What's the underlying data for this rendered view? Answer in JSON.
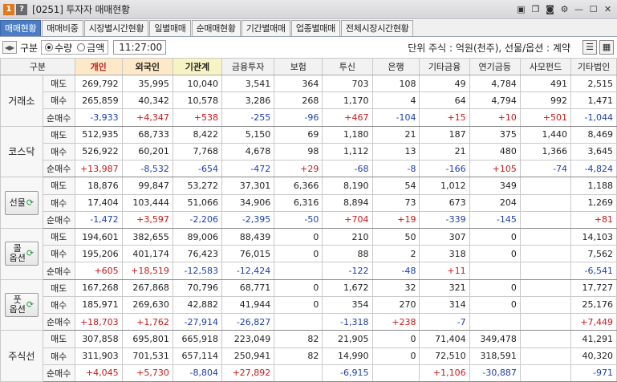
{
  "titlebar": {
    "badge_one": "1",
    "badge_q": "?",
    "title": "[0251] 투자자 매매현황",
    "icons": [
      "window-icon",
      "copy-icon",
      "camera-icon",
      "gear-icon",
      "minimize-icon",
      "maximize-icon",
      "close-icon"
    ]
  },
  "tabs": [
    "매매현황",
    "매매비중",
    "시장별시간현황",
    "일별매매",
    "순매매현황",
    "기간별매매",
    "업종별매매",
    "전체시장시간현황"
  ],
  "controls": {
    "group_label": "구분",
    "radio_qty": "수량",
    "radio_amount": "금액",
    "time": "11:27:00",
    "unit_text": "단위 주식 : 억원(천주), 선물/옵션 : 계약"
  },
  "table": {
    "columns": [
      "구분",
      "",
      "개인",
      "외국인",
      "기관계",
      "금융투자",
      "보험",
      "투신",
      "은행",
      "기타금융",
      "연기금등",
      "사모펀드",
      "기타법인"
    ],
    "groups": [
      {
        "name": "거래소",
        "button": false,
        "rows": [
          {
            "label": "매도",
            "values": [
              "269,792",
              "35,995",
              "10,040",
              "3,541",
              "364",
              "703",
              "108",
              "49",
              "4,784",
              "491",
              "2,515"
            ]
          },
          {
            "label": "매수",
            "values": [
              "265,859",
              "40,342",
              "10,578",
              "3,286",
              "268",
              "1,170",
              "4",
              "64",
              "4,794",
              "992",
              "1,471"
            ]
          },
          {
            "label": "순매수",
            "values": [
              "-3,933",
              "+4,347",
              "+538",
              "-255",
              "-96",
              "+467",
              "-104",
              "+15",
              "+10",
              "+501",
              "-1,044"
            ]
          }
        ]
      },
      {
        "name": "코스닥",
        "button": false,
        "rows": [
          {
            "label": "매도",
            "values": [
              "512,935",
              "68,733",
              "8,422",
              "5,150",
              "69",
              "1,180",
              "21",
              "187",
              "375",
              "1,440",
              "8,469"
            ]
          },
          {
            "label": "매수",
            "values": [
              "526,922",
              "60,201",
              "7,768",
              "4,678",
              "98",
              "1,112",
              "13",
              "21",
              "480",
              "1,366",
              "3,645"
            ]
          },
          {
            "label": "순매수",
            "values": [
              "+13,987",
              "-8,532",
              "-654",
              "-472",
              "+29",
              "-68",
              "-8",
              "-166",
              "+105",
              "-74",
              "-4,824"
            ]
          }
        ]
      },
      {
        "name": "선물",
        "button": true,
        "rows": [
          {
            "label": "매도",
            "values": [
              "18,876",
              "99,847",
              "53,272",
              "37,301",
              "6,366",
              "8,190",
              "54",
              "1,012",
              "349",
              "",
              "1,188"
            ]
          },
          {
            "label": "매수",
            "values": [
              "17,404",
              "103,444",
              "51,066",
              "34,906",
              "6,316",
              "8,894",
              "73",
              "673",
              "204",
              "",
              "1,269"
            ]
          },
          {
            "label": "순매수",
            "values": [
              "-1,472",
              "+3,597",
              "-2,206",
              "-2,395",
              "-50",
              "+704",
              "+19",
              "-339",
              "-145",
              "",
              "+81"
            ]
          }
        ]
      },
      {
        "name": "콜\n옵션",
        "button": true,
        "rows": [
          {
            "label": "매도",
            "values": [
              "194,601",
              "382,655",
              "89,006",
              "88,439",
              "0",
              "210",
              "50",
              "307",
              "0",
              "",
              "14,103"
            ]
          },
          {
            "label": "매수",
            "values": [
              "195,206",
              "401,174",
              "76,423",
              "76,015",
              "0",
              "88",
              "2",
              "318",
              "0",
              "",
              "7,562"
            ]
          },
          {
            "label": "순매수",
            "values": [
              "+605",
              "+18,519",
              "-12,583",
              "-12,424",
              "",
              "-122",
              "-48",
              "+11",
              "",
              "",
              "-6,541"
            ]
          }
        ]
      },
      {
        "name": "풋\n옵션",
        "button": true,
        "rows": [
          {
            "label": "매도",
            "values": [
              "167,268",
              "267,868",
              "70,796",
              "68,771",
              "0",
              "1,672",
              "32",
              "321",
              "0",
              "",
              "17,727"
            ]
          },
          {
            "label": "매수",
            "values": [
              "185,971",
              "269,630",
              "42,882",
              "41,944",
              "0",
              "354",
              "270",
              "314",
              "0",
              "",
              "25,176"
            ]
          },
          {
            "label": "순매수",
            "values": [
              "+18,703",
              "+1,762",
              "-27,914",
              "-26,827",
              "",
              "-1,318",
              "+238",
              "-7",
              "",
              "",
              "+7,449"
            ]
          }
        ]
      },
      {
        "name": "주식선",
        "button": false,
        "rows": [
          {
            "label": "매도",
            "values": [
              "307,858",
              "695,801",
              "665,918",
              "223,049",
              "82",
              "21,905",
              "0",
              "71,404",
              "349,478",
              "",
              "41,291"
            ]
          },
          {
            "label": "매수",
            "values": [
              "311,903",
              "701,531",
              "657,114",
              "250,941",
              "82",
              "14,990",
              "0",
              "72,510",
              "318,591",
              "",
              "40,320"
            ]
          },
          {
            "label": "순매수",
            "values": [
              "+4,045",
              "+5,730",
              "-8,804",
              "+27,892",
              "",
              "-6,915",
              "",
              "+1,106",
              "-30,887",
              "",
              "-971"
            ]
          }
        ]
      }
    ]
  },
  "colors": {
    "positive": "#d01515",
    "negative": "#1a3fb0",
    "active_tab": "#4b7dc6"
  }
}
